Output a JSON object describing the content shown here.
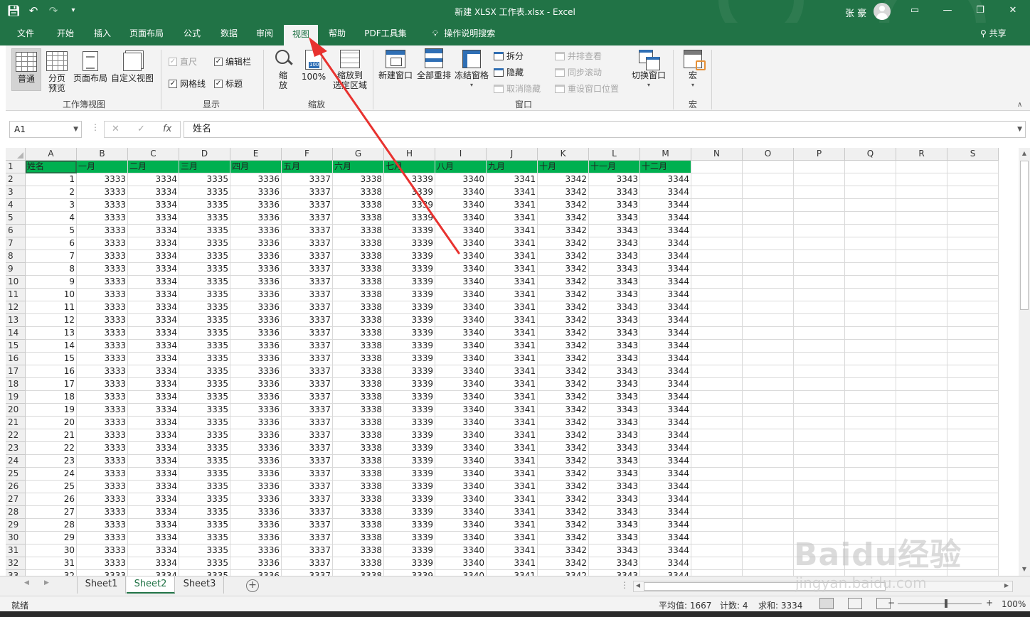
{
  "window": {
    "title": "新建 XLSX 工作表.xlsx  -  Excel",
    "user": "张 豪",
    "share": "共享"
  },
  "tabs": [
    "文件",
    "开始",
    "插入",
    "页面布局",
    "公式",
    "数据",
    "审阅",
    "视图",
    "帮助",
    "PDF工具集",
    "操作说明搜索"
  ],
  "ribbon": {
    "workbook_views": {
      "label": "工作簿视图",
      "normal": "普通",
      "page_break_1": "分页",
      "page_break_2": "预览",
      "page_layout": "页面布局",
      "custom_views": "自定义视图"
    },
    "show": {
      "label": "显示",
      "ruler": "直尺",
      "formula_bar": "编辑栏",
      "gridlines": "网格线",
      "headings": "标题"
    },
    "zoom": {
      "label": "缩放",
      "zoom_1": "缩",
      "zoom_2": "放",
      "hundred": "100%",
      "to_sel_1": "缩放到",
      "to_sel_2": "选定区域"
    },
    "window": {
      "label": "窗口",
      "new_window": "新建窗口",
      "arrange_all": "全部重排",
      "freeze": "冻结窗格",
      "split": "拆分",
      "hide": "隐藏",
      "unhide": "取消隐藏",
      "side_by_side": "并排查看",
      "sync_scroll": "同步滚动",
      "reset_pos": "重设窗口位置",
      "switch_windows": "切换窗口"
    },
    "macros": {
      "label": "宏",
      "macros": "宏"
    }
  },
  "formula_bar": {
    "name_box": "A1",
    "content": "姓名"
  },
  "grid": {
    "columns": [
      "A",
      "B",
      "C",
      "D",
      "E",
      "F",
      "G",
      "H",
      "I",
      "J",
      "K",
      "L",
      "M",
      "N",
      "O",
      "P",
      "Q",
      "R",
      "S"
    ],
    "header_row": [
      "姓名",
      "一月",
      "二月",
      "三月",
      "四月",
      "五月",
      "六月",
      "七月",
      "八月",
      "九月",
      "十月",
      "十一月",
      "十二月"
    ],
    "monthly_values": [
      3333,
      3334,
      3335,
      3336,
      3337,
      3338,
      3339,
      3340,
      3341,
      3342,
      3343,
      3344
    ],
    "first_row_number": 1,
    "last_row_number": 33,
    "first_index": 1,
    "last_index": 32
  },
  "sheets": [
    "Sheet1",
    "Sheet2",
    "Sheet3"
  ],
  "active_sheet": "Sheet2",
  "status": {
    "ready": "就绪",
    "average": "平均值: 1667",
    "count": "计数: 4",
    "sum": "求和: 3334",
    "zoom": "100%"
  },
  "watermark": {
    "brand": "Baidu经验",
    "url": "jingyan.baidu.com"
  },
  "colors": {
    "excel_green": "#217346",
    "header_fill": "#00b050",
    "annotation_arrow": "#e8322f"
  }
}
